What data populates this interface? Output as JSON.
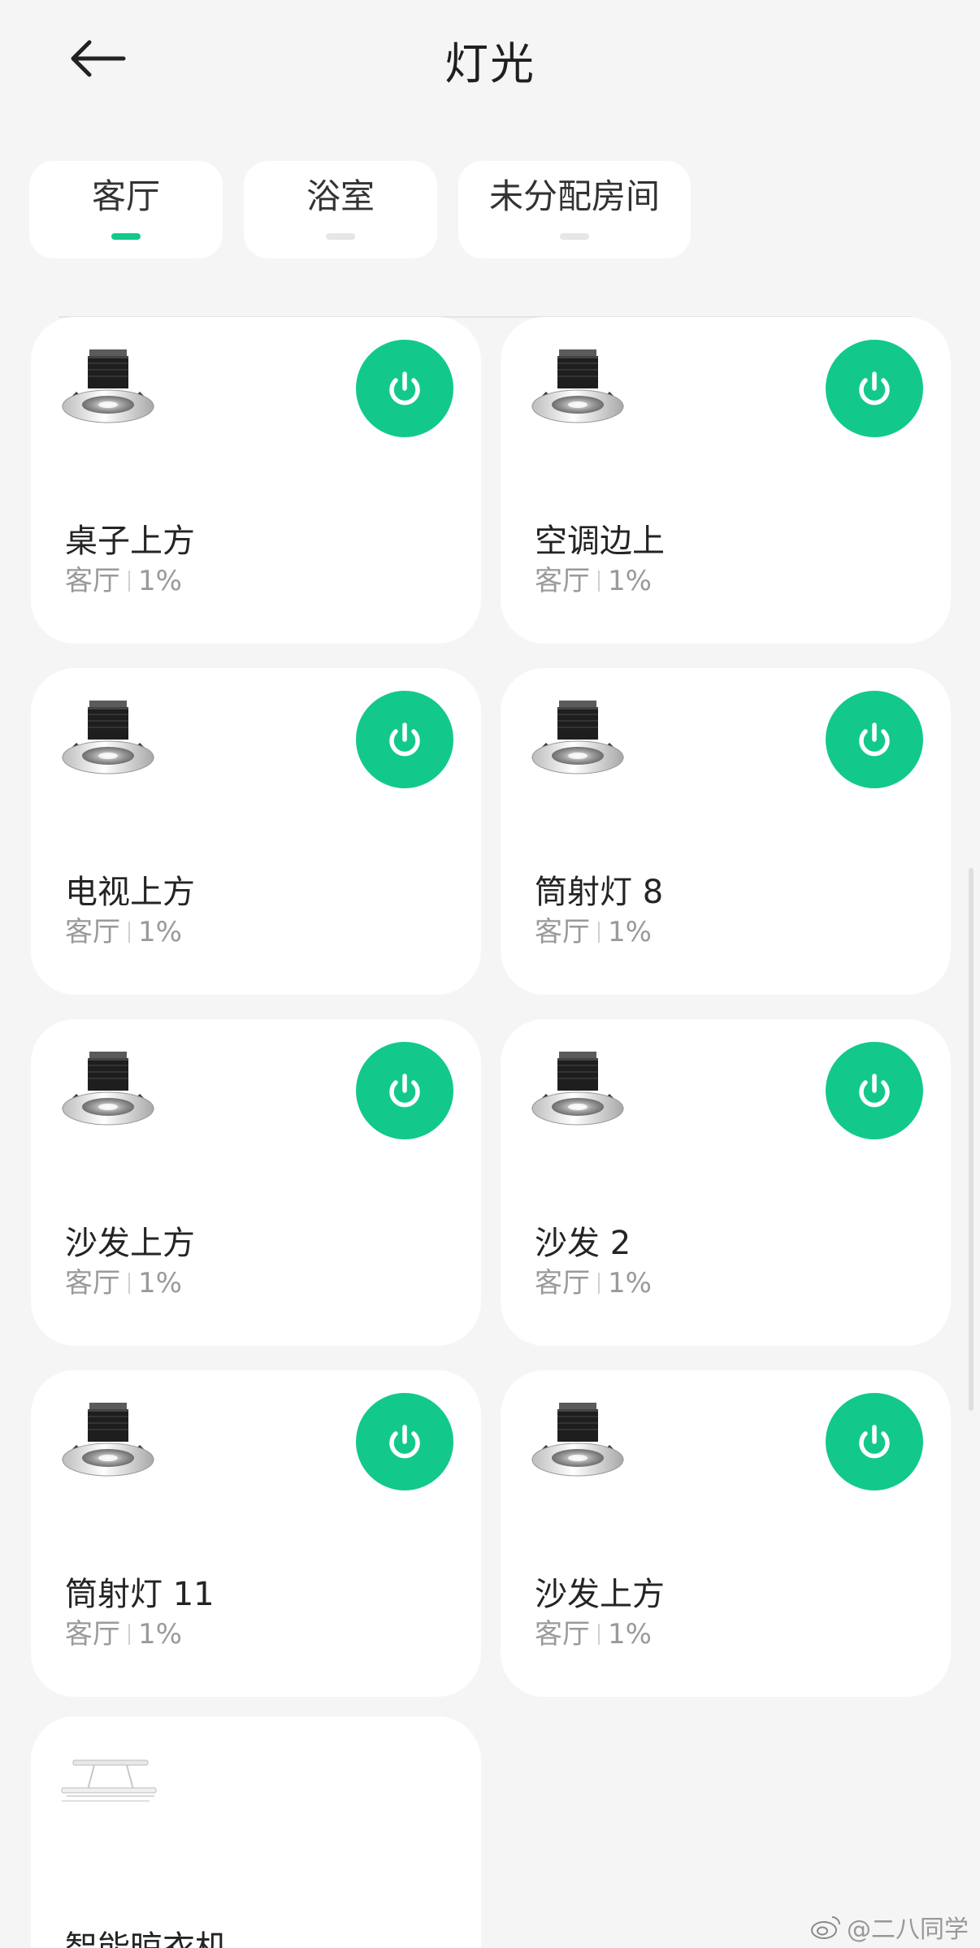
{
  "header": {
    "title": "灯光",
    "back_icon": "arrow-left-icon"
  },
  "tabs": [
    {
      "label": "客厅",
      "active": true
    },
    {
      "label": "浴室",
      "active": false
    },
    {
      "label": "未分配房间",
      "active": false
    }
  ],
  "devices": [
    {
      "name": "桌子上方",
      "room": "客厅",
      "brightness": "1%",
      "on": true,
      "icon": "downlight-icon"
    },
    {
      "name": "空调边上",
      "room": "客厅",
      "brightness": "1%",
      "on": true,
      "icon": "downlight-icon"
    },
    {
      "name": "电视上方",
      "room": "客厅",
      "brightness": "1%",
      "on": true,
      "icon": "downlight-icon"
    },
    {
      "name": "筒射灯 8",
      "room": "客厅",
      "brightness": "1%",
      "on": true,
      "icon": "downlight-icon"
    },
    {
      "name": "沙发上方",
      "room": "客厅",
      "brightness": "1%",
      "on": true,
      "icon": "downlight-icon"
    },
    {
      "name": "沙发 2",
      "room": "客厅",
      "brightness": "1%",
      "on": true,
      "icon": "downlight-icon"
    },
    {
      "name": "筒射灯 11",
      "room": "客厅",
      "brightness": "1%",
      "on": true,
      "icon": "downlight-icon"
    },
    {
      "name": "沙发上方",
      "room": "客厅",
      "brightness": "1%",
      "on": true,
      "icon": "downlight-icon"
    },
    {
      "name": "智能晾衣机",
      "icon": "clothes-dryer-icon"
    }
  ],
  "watermark": "@二八同学",
  "colors": {
    "accent": "#12c98b",
    "background": "#f5f5f5",
    "card": "#ffffff"
  }
}
